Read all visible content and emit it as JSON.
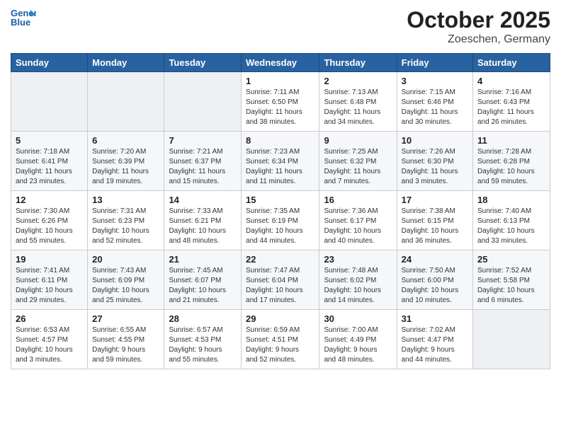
{
  "header": {
    "logo_line1": "General",
    "logo_line2": "Blue",
    "month": "October 2025",
    "location": "Zoeschen, Germany"
  },
  "weekdays": [
    "Sunday",
    "Monday",
    "Tuesday",
    "Wednesday",
    "Thursday",
    "Friday",
    "Saturday"
  ],
  "weeks": [
    [
      {
        "day": "",
        "info": ""
      },
      {
        "day": "",
        "info": ""
      },
      {
        "day": "",
        "info": ""
      },
      {
        "day": "1",
        "info": "Sunrise: 7:11 AM\nSunset: 6:50 PM\nDaylight: 11 hours\nand 38 minutes."
      },
      {
        "day": "2",
        "info": "Sunrise: 7:13 AM\nSunset: 6:48 PM\nDaylight: 11 hours\nand 34 minutes."
      },
      {
        "day": "3",
        "info": "Sunrise: 7:15 AM\nSunset: 6:46 PM\nDaylight: 11 hours\nand 30 minutes."
      },
      {
        "day": "4",
        "info": "Sunrise: 7:16 AM\nSunset: 6:43 PM\nDaylight: 11 hours\nand 26 minutes."
      }
    ],
    [
      {
        "day": "5",
        "info": "Sunrise: 7:18 AM\nSunset: 6:41 PM\nDaylight: 11 hours\nand 23 minutes."
      },
      {
        "day": "6",
        "info": "Sunrise: 7:20 AM\nSunset: 6:39 PM\nDaylight: 11 hours\nand 19 minutes."
      },
      {
        "day": "7",
        "info": "Sunrise: 7:21 AM\nSunset: 6:37 PM\nDaylight: 11 hours\nand 15 minutes."
      },
      {
        "day": "8",
        "info": "Sunrise: 7:23 AM\nSunset: 6:34 PM\nDaylight: 11 hours\nand 11 minutes."
      },
      {
        "day": "9",
        "info": "Sunrise: 7:25 AM\nSunset: 6:32 PM\nDaylight: 11 hours\nand 7 minutes."
      },
      {
        "day": "10",
        "info": "Sunrise: 7:26 AM\nSunset: 6:30 PM\nDaylight: 11 hours\nand 3 minutes."
      },
      {
        "day": "11",
        "info": "Sunrise: 7:28 AM\nSunset: 6:28 PM\nDaylight: 10 hours\nand 59 minutes."
      }
    ],
    [
      {
        "day": "12",
        "info": "Sunrise: 7:30 AM\nSunset: 6:26 PM\nDaylight: 10 hours\nand 55 minutes."
      },
      {
        "day": "13",
        "info": "Sunrise: 7:31 AM\nSunset: 6:23 PM\nDaylight: 10 hours\nand 52 minutes."
      },
      {
        "day": "14",
        "info": "Sunrise: 7:33 AM\nSunset: 6:21 PM\nDaylight: 10 hours\nand 48 minutes."
      },
      {
        "day": "15",
        "info": "Sunrise: 7:35 AM\nSunset: 6:19 PM\nDaylight: 10 hours\nand 44 minutes."
      },
      {
        "day": "16",
        "info": "Sunrise: 7:36 AM\nSunset: 6:17 PM\nDaylight: 10 hours\nand 40 minutes."
      },
      {
        "day": "17",
        "info": "Sunrise: 7:38 AM\nSunset: 6:15 PM\nDaylight: 10 hours\nand 36 minutes."
      },
      {
        "day": "18",
        "info": "Sunrise: 7:40 AM\nSunset: 6:13 PM\nDaylight: 10 hours\nand 33 minutes."
      }
    ],
    [
      {
        "day": "19",
        "info": "Sunrise: 7:41 AM\nSunset: 6:11 PM\nDaylight: 10 hours\nand 29 minutes."
      },
      {
        "day": "20",
        "info": "Sunrise: 7:43 AM\nSunset: 6:09 PM\nDaylight: 10 hours\nand 25 minutes."
      },
      {
        "day": "21",
        "info": "Sunrise: 7:45 AM\nSunset: 6:07 PM\nDaylight: 10 hours\nand 21 minutes."
      },
      {
        "day": "22",
        "info": "Sunrise: 7:47 AM\nSunset: 6:04 PM\nDaylight: 10 hours\nand 17 minutes."
      },
      {
        "day": "23",
        "info": "Sunrise: 7:48 AM\nSunset: 6:02 PM\nDaylight: 10 hours\nand 14 minutes."
      },
      {
        "day": "24",
        "info": "Sunrise: 7:50 AM\nSunset: 6:00 PM\nDaylight: 10 hours\nand 10 minutes."
      },
      {
        "day": "25",
        "info": "Sunrise: 7:52 AM\nSunset: 5:58 PM\nDaylight: 10 hours\nand 6 minutes."
      }
    ],
    [
      {
        "day": "26",
        "info": "Sunrise: 6:53 AM\nSunset: 4:57 PM\nDaylight: 10 hours\nand 3 minutes."
      },
      {
        "day": "27",
        "info": "Sunrise: 6:55 AM\nSunset: 4:55 PM\nDaylight: 9 hours\nand 59 minutes."
      },
      {
        "day": "28",
        "info": "Sunrise: 6:57 AM\nSunset: 4:53 PM\nDaylight: 9 hours\nand 55 minutes."
      },
      {
        "day": "29",
        "info": "Sunrise: 6:59 AM\nSunset: 4:51 PM\nDaylight: 9 hours\nand 52 minutes."
      },
      {
        "day": "30",
        "info": "Sunrise: 7:00 AM\nSunset: 4:49 PM\nDaylight: 9 hours\nand 48 minutes."
      },
      {
        "day": "31",
        "info": "Sunrise: 7:02 AM\nSunset: 4:47 PM\nDaylight: 9 hours\nand 44 minutes."
      },
      {
        "day": "",
        "info": ""
      }
    ]
  ]
}
